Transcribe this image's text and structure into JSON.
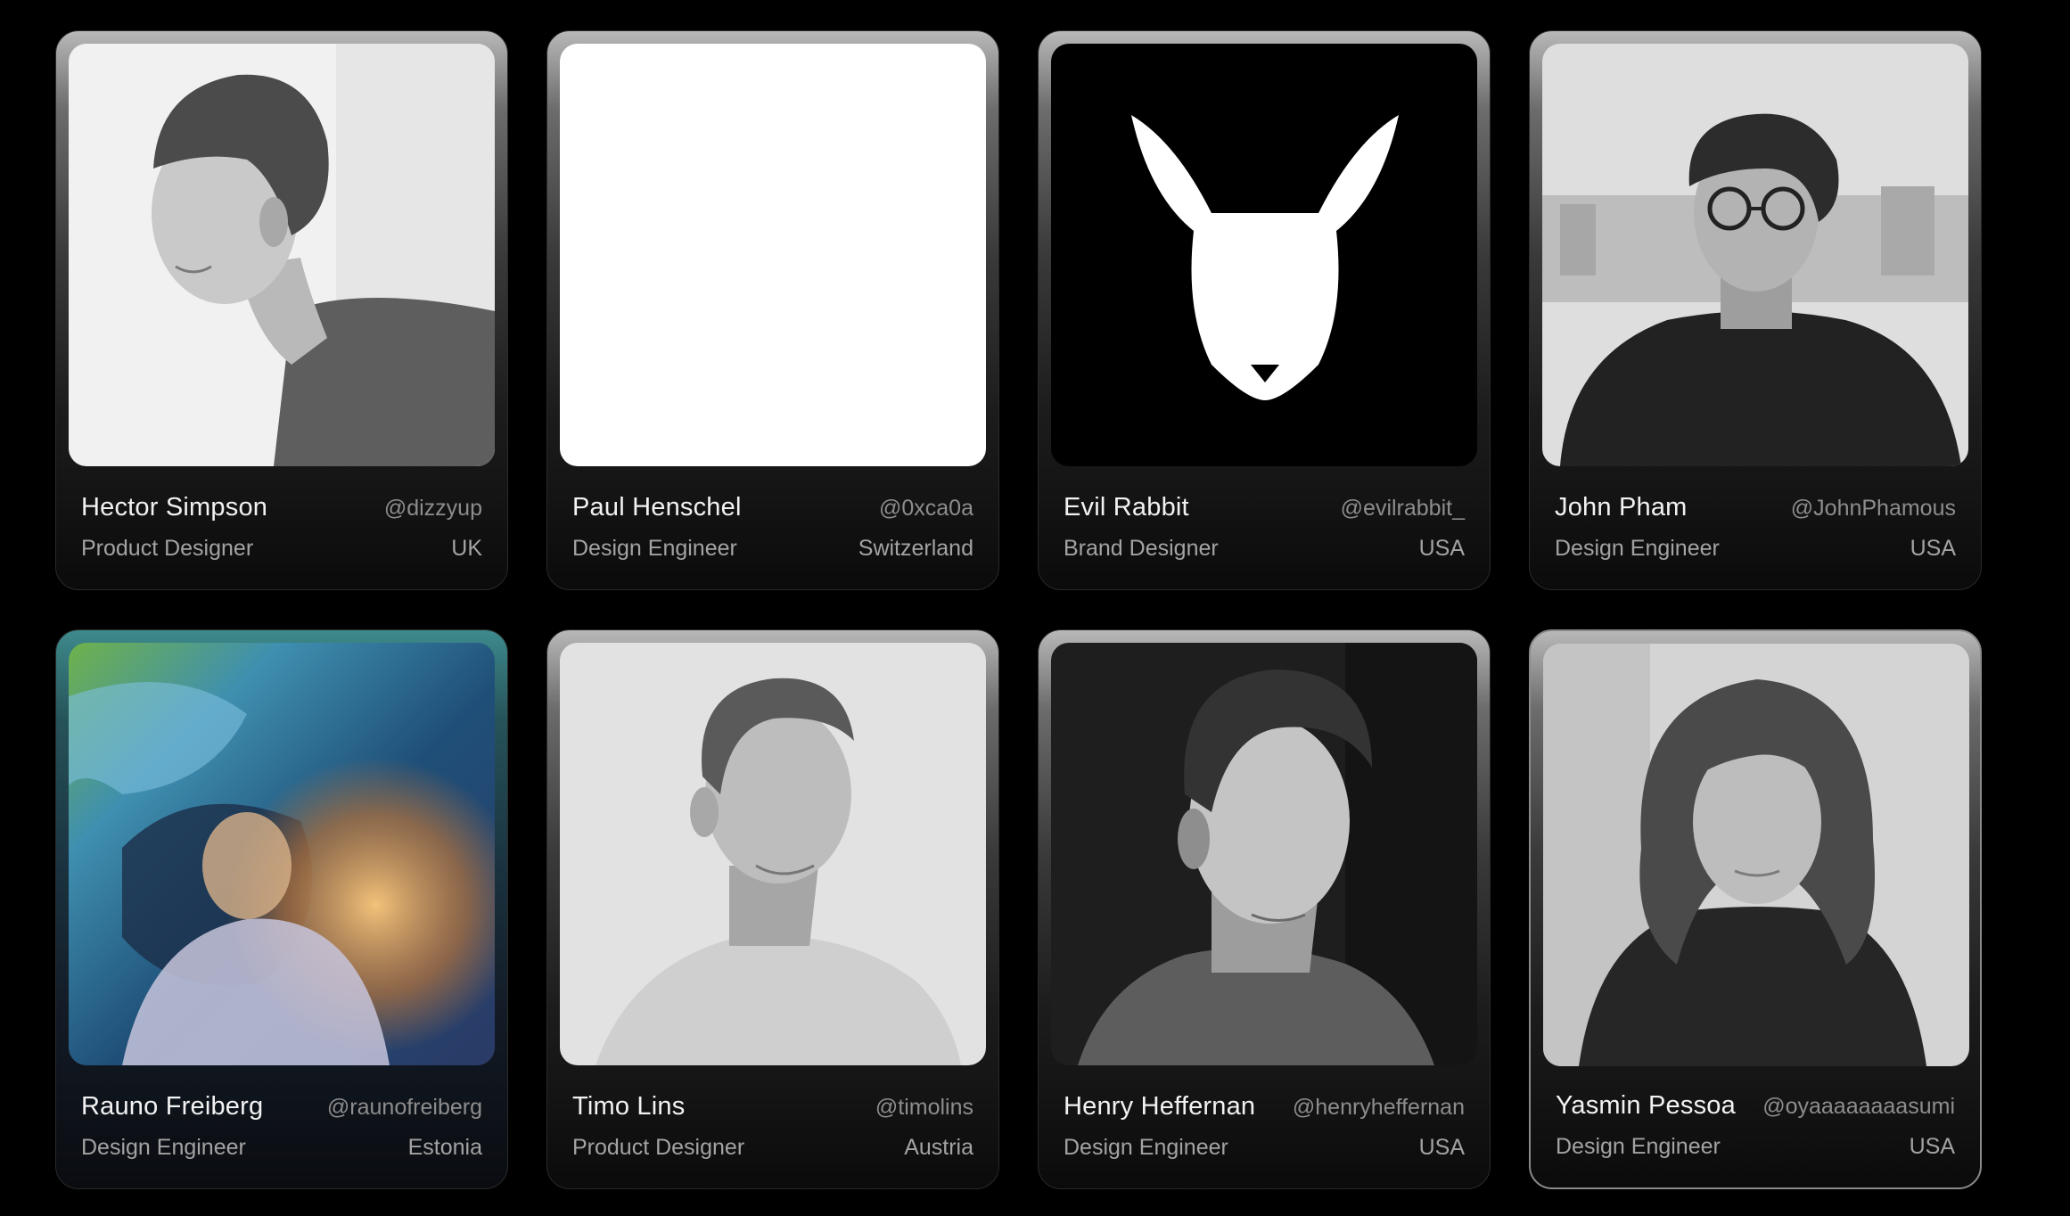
{
  "people": [
    {
      "name": "Hector Simpson",
      "handle": "@dizzyup",
      "role": "Product Designer",
      "country": "UK"
    },
    {
      "name": "Paul Henschel",
      "handle": "@0xca0a",
      "role": "Design Engineer",
      "country": "Switzerland"
    },
    {
      "name": "Evil Rabbit",
      "handle": "@evilrabbit_",
      "role": "Brand Designer",
      "country": "USA"
    },
    {
      "name": "John Pham",
      "handle": "@JohnPhamous",
      "role": "Design Engineer",
      "country": "USA"
    },
    {
      "name": "Rauno Freiberg",
      "handle": "@raunofreiberg",
      "role": "Design Engineer",
      "country": "Estonia"
    },
    {
      "name": "Timo Lins",
      "handle": "@timolins",
      "role": "Product Designer",
      "country": "Austria"
    },
    {
      "name": "Henry Heffernan",
      "handle": "@henryheffernan",
      "role": "Design Engineer",
      "country": "USA"
    },
    {
      "name": "Yasmin Pessoa",
      "handle": "@oyaaaaaaaasumi",
      "role": "Design Engineer",
      "country": "USA"
    }
  ],
  "colors": {
    "background": "#000000",
    "name": "#f2f2f2",
    "meta": "#a3a3a3",
    "handle": "#8d8d8d"
  }
}
